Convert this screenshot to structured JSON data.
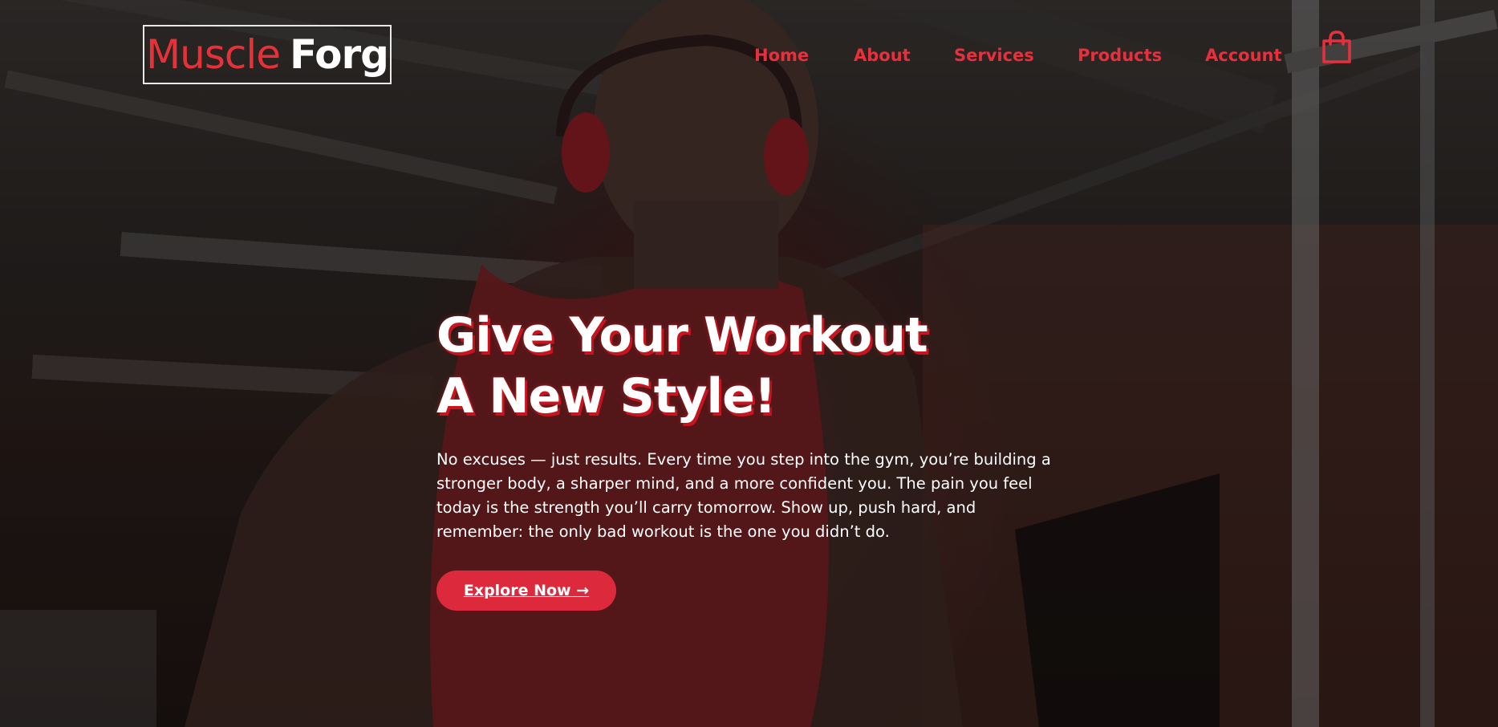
{
  "brand": {
    "name_red": "Muscle",
    "name_white": "Forg"
  },
  "nav": {
    "items": [
      {
        "label": "Home"
      },
      {
        "label": "About"
      },
      {
        "label": "Services"
      },
      {
        "label": "Products"
      },
      {
        "label": "Account"
      }
    ],
    "cart_icon": "shopping-bag-icon"
  },
  "hero": {
    "title_line1": "Give Your Workout",
    "title_line2": "A New Style!",
    "description": "No excuses — just results. Every time you step into the gym, you’re building a stronger body, a sharper mind, and a more confident you. The pain you feel today is the strength you’ll carry tomorrow. Show up, push hard, and remember: the only bad workout is the one you didn’t do.",
    "cta_label": "Explore Now →"
  },
  "colors": {
    "accent": "#e8303c",
    "button": "#dc2a3c",
    "text": "#ffffff"
  }
}
